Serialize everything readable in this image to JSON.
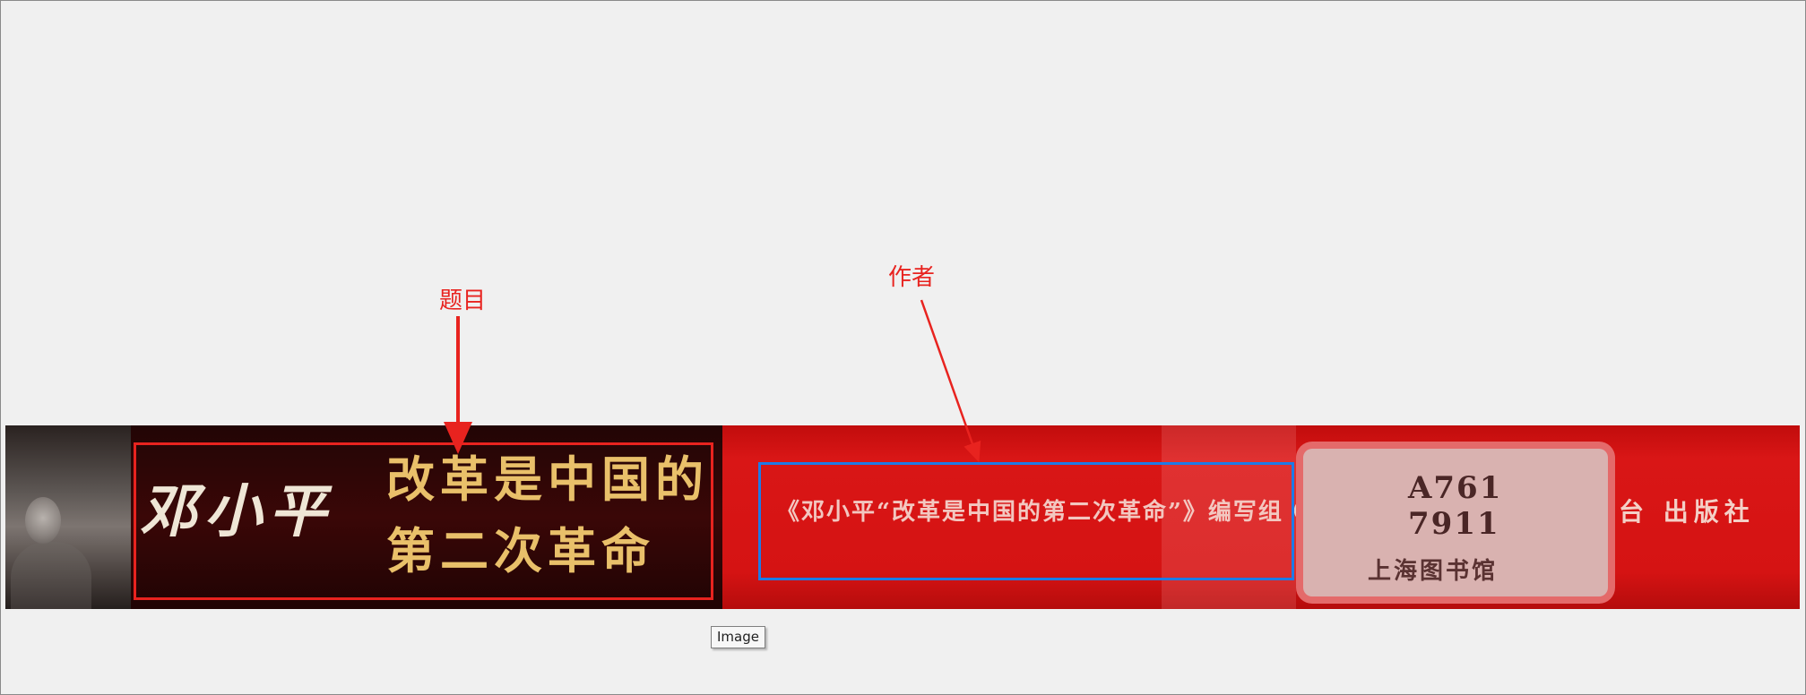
{
  "annotations": {
    "title_label": "题目",
    "author_label": "作者",
    "title_box_color": "#e8231f",
    "author_box_color": "#1e7be6"
  },
  "spine": {
    "signature": "邓小平",
    "title_line_1": "改革是中国的",
    "title_line_2": "第二次革命",
    "author_text": "《邓小平“改革是中国的第二次革命”》编写组 〇",
    "call_number_line_1": "A761",
    "call_number_line_2": "7911",
    "library": "上海图书馆",
    "publisher": "台 出版社"
  },
  "tooltip": {
    "text": "Image"
  }
}
